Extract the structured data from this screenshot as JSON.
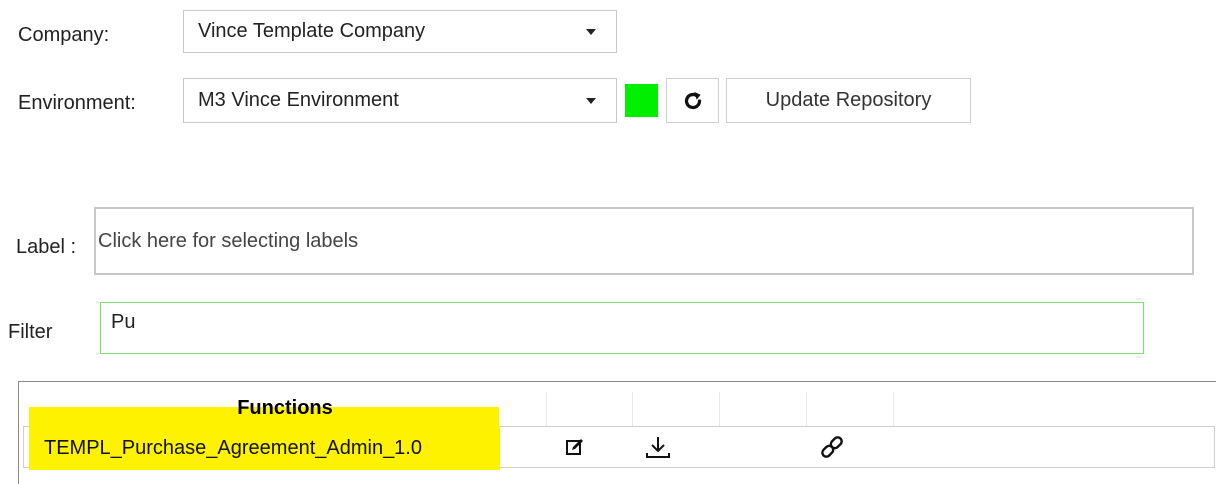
{
  "company": {
    "label": "Company:",
    "value": "Vince Template Company"
  },
  "environment": {
    "label": "Environment:",
    "value": "M3 Vince Environment",
    "status_color": "#00ee00",
    "refresh_icon": "refresh-icon",
    "update_button": "Update Repository"
  },
  "label_field": {
    "label": "Label :",
    "placeholder": "Click here for selecting labels"
  },
  "filter": {
    "label": "Filter",
    "value": "Pu"
  },
  "grid": {
    "header": "Functions",
    "rows": [
      {
        "name": "TEMPL_Purchase_Agreement_Admin_1.0",
        "icons": [
          "edit-icon",
          "download-icon",
          "link-icon"
        ]
      }
    ],
    "highlight_color": "#fff200"
  }
}
